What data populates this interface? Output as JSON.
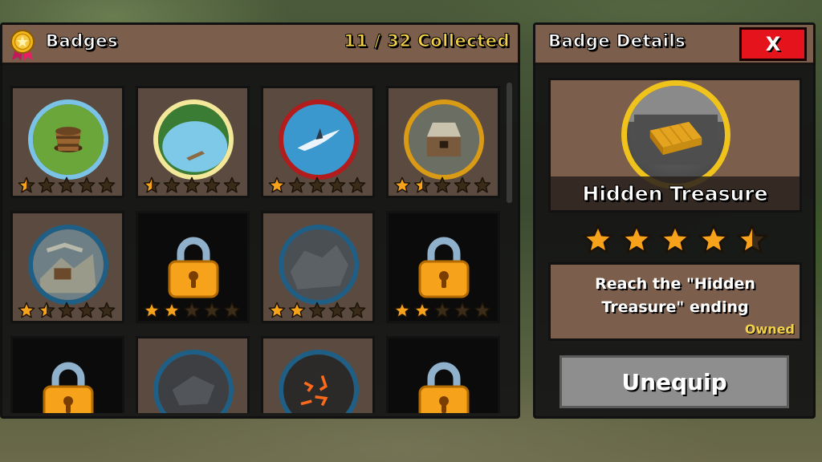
{
  "badges_panel": {
    "title": "Badges",
    "collected": "11 / 32 Collected",
    "badges": [
      {
        "locked": false,
        "art": "bucket",
        "ring": "#7ac3e6",
        "rating": 0.5
      },
      {
        "locked": false,
        "art": "lake",
        "ring": "#f3e79a",
        "rating": 0.5
      },
      {
        "locked": false,
        "art": "shark",
        "ring": "#b31c1c",
        "rating": 1
      },
      {
        "locked": false,
        "art": "chest",
        "ring": "#d99a16",
        "rating": 1.5
      },
      {
        "locked": false,
        "art": "ruins",
        "ring": "#1f5f86",
        "rating": 1.5
      },
      {
        "locked": true,
        "rating": 2
      },
      {
        "locked": false,
        "art": "rocks",
        "ring": "#1f5f86",
        "rating": 2
      },
      {
        "locked": true,
        "rating": 2
      },
      {
        "locked": true,
        "rating": null
      },
      {
        "locked": false,
        "art": "wreck",
        "ring": "#1f5f86",
        "rating": null
      },
      {
        "locked": false,
        "art": "lava",
        "ring": "#1f5f86",
        "rating": null
      },
      {
        "locked": true,
        "rating": null
      }
    ]
  },
  "details_panel": {
    "title": "Badge Details",
    "close_label": "X",
    "badge_name": "Hidden Treasure",
    "rating": 4.5,
    "description": "Reach the \"Hidden Treasure\" ending",
    "status": "Owned",
    "action_label": "Unequip"
  },
  "colors": {
    "panel_brown": "#7b5e4b",
    "accent_gold": "#f3d24a",
    "close_red": "#e5131c",
    "star_orange": "#f7a21b",
    "star_empty": "#3a2c18"
  },
  "icons": {
    "header_icon": "medal-icon",
    "locked_icon": "padlock-icon",
    "rating_icon": "star-icon"
  }
}
